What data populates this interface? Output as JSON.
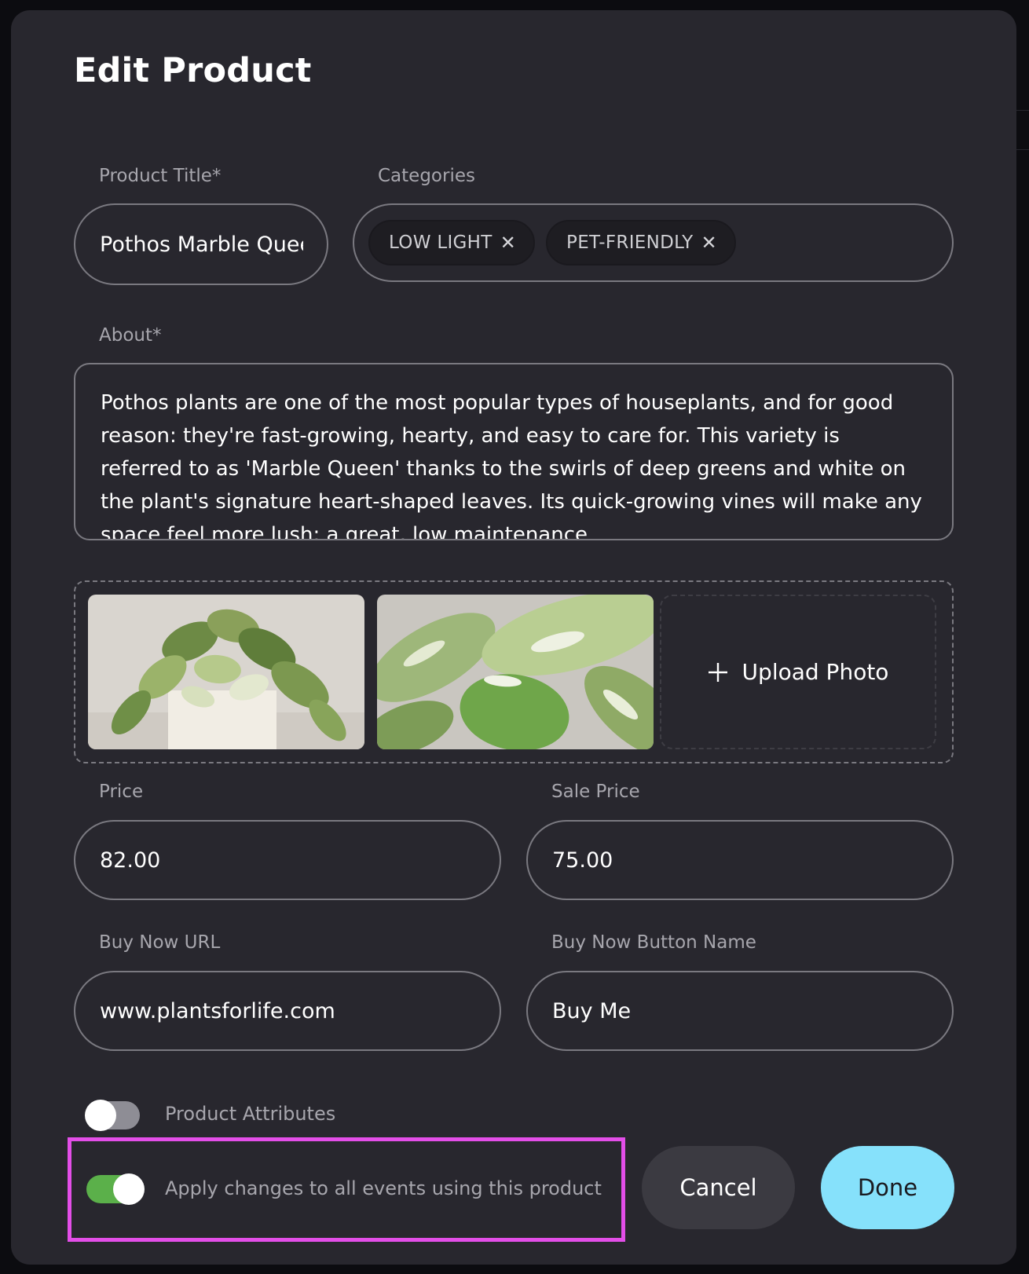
{
  "modal": {
    "title": "Edit Product"
  },
  "fields": {
    "product_title": {
      "label": "Product Title*",
      "value": "Pothos Marble Queen"
    },
    "categories": {
      "label": "Categories",
      "chips": [
        {
          "label": "LOW LIGHT",
          "remove": "✕"
        },
        {
          "label": "PET-FRIENDLY",
          "remove": "✕"
        }
      ]
    },
    "about": {
      "label": "About*",
      "value": "Pothos plants are one of the most popular types of houseplants, and for good reason: they're fast-growing, hearty, and easy to care for. This variety is referred to as 'Marble Queen' thanks to the swirls of deep greens and white on the plant's signature heart-shaped leaves. Its quick-growing vines will make any space feel more lush; a great, low maintenance"
    },
    "photos": {
      "upload_label": "Upload Photo",
      "upload_icon": "plus-icon"
    },
    "price": {
      "label": "Price",
      "value": "82.00"
    },
    "sale_price": {
      "label": "Sale Price",
      "value": "75.00"
    },
    "buy_now_url": {
      "label": "Buy Now URL",
      "value": "www.plantsforlife.com"
    },
    "buy_now_button_name": {
      "label": "Buy Now Button Name",
      "value": "Buy Me"
    }
  },
  "toggles": {
    "product_attributes": {
      "label": "Product Attributes",
      "on": false
    },
    "apply_all": {
      "label": "Apply changes to all events using this product",
      "on": true
    }
  },
  "actions": {
    "cancel_label": "Cancel",
    "done_label": "Done"
  },
  "colors": {
    "modal_bg": "#28272e",
    "accent_done": "#86e1fb",
    "toggle_on": "#5bb04a",
    "toggle_off": "#8e8d95",
    "highlight": "#e34ee8"
  }
}
